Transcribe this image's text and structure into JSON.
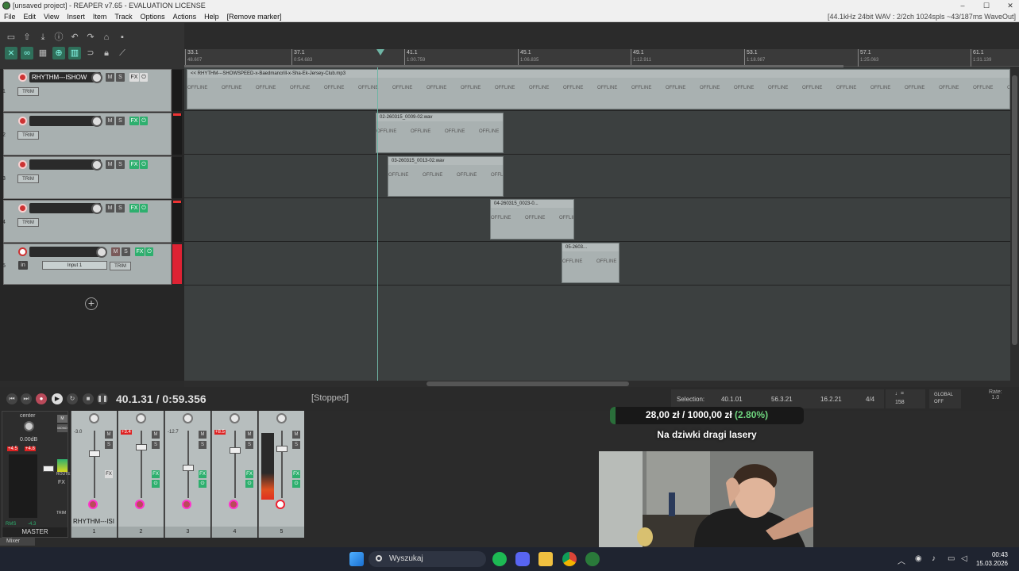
{
  "window": {
    "title": "[unsaved project] - REAPER v7.65 - EVALUATION LICENSE",
    "controls": [
      "–",
      "☐",
      "✕"
    ]
  },
  "menu": {
    "items": [
      "File",
      "Edit",
      "View",
      "Insert",
      "Item",
      "Track",
      "Options",
      "Actions",
      "Help",
      "[Remove marker]"
    ],
    "status": "[44.1kHz 24bit WAV : 2/2ch 1024spls ~43/187ms WaveOut]"
  },
  "ruler": {
    "marks": [
      {
        "bar": "33.1",
        "time": "48.607"
      },
      {
        "bar": "37.1",
        "time": "0:54.683"
      },
      {
        "bar": "41.1",
        "time": "1:00.759"
      },
      {
        "bar": "45.1",
        "time": "1:06.835"
      },
      {
        "bar": "49.1",
        "time": "1:12.911"
      },
      {
        "bar": "53.1",
        "time": "1:18.987"
      },
      {
        "bar": "57.1",
        "time": "1:25.063"
      },
      {
        "bar": "61.1",
        "time": "1:31.139"
      }
    ]
  },
  "tracks": [
    {
      "num": "1",
      "name": "RHYTHM---ISHOW",
      "fx": "FX",
      "trim": "TRIM"
    },
    {
      "num": "2",
      "name": "",
      "fx": "FX",
      "trim": "TRIM"
    },
    {
      "num": "3",
      "name": "",
      "fx": "FX",
      "trim": "TRIM"
    },
    {
      "num": "4",
      "name": "",
      "fx": "FX",
      "trim": "TRIM"
    },
    {
      "num": "5",
      "name": "",
      "fx": "FX",
      "trim": "TRIM",
      "input": "Input 1",
      "in": "in"
    }
  ],
  "track_buttons": {
    "mute": "M",
    "solo": "S"
  },
  "items": [
    {
      "label": "<< RHYTHM---SHOWSPEED-x-Baedmancrill-x-Sha-Ek-Jersey-Club.mp3",
      "offline": "OFFLINE"
    },
    {
      "label": "02-260315_0009-02.wav",
      "offline": "OFFLINE"
    },
    {
      "label": "03-260315_0013-02.wav",
      "offline": "OFFLINE"
    },
    {
      "label": "04-260315_0023-0...",
      "offline": "OFFLINE"
    },
    {
      "label": "05-2603...",
      "offline": "OFFLINE"
    }
  ],
  "transport": {
    "time": "40.1.31 / 0:59.356",
    "state": "[Stopped]",
    "selection_label": "Selection:",
    "selection_start": "40.1.01",
    "selection_end": "56.3.21",
    "selection_length": "16.2.21",
    "timesig": "4/4",
    "bpm": "158",
    "global": "GLOBAL",
    "global_state": "OFF",
    "rate_label": "Rate:",
    "rate_value": "1.0"
  },
  "mixer": {
    "master_label": "MASTER",
    "master_pan": "center",
    "master_db": "0.00dB",
    "master_peak_l": "+4.5",
    "master_peak_r": "+4.8",
    "master_rms": "RMS",
    "master_rms_val": "-4.3",
    "master_buttons": [
      "MONO",
      "ROUTE",
      "FX",
      "TRIM"
    ],
    "strips": [
      {
        "num": "1",
        "name": "RHYTHM---ISI",
        "db": "-3.0",
        "peak": false
      },
      {
        "num": "2",
        "name": "",
        "db": "+3.4",
        "peak": true
      },
      {
        "num": "3",
        "name": "",
        "db": "-12.7",
        "peak": false
      },
      {
        "num": "4",
        "name": "",
        "db": "+8.5",
        "peak": true
      },
      {
        "num": "5",
        "name": "",
        "db": "",
        "peak": false
      }
    ],
    "tab": "Mixer"
  },
  "overlay": {
    "donation_amount": "28,00 zł",
    "donation_separator": "/",
    "donation_goal": "1000,00 zł",
    "donation_pct": "(2.80%)",
    "donation_progress": 0.028,
    "donation_title": "Na dziwki dragi lasery"
  },
  "taskbar": {
    "search_placeholder": "Wyszukaj",
    "time": "00:43",
    "date": "15.03.2026"
  },
  "colors": {
    "accent": "#6fb5a5",
    "fx_on": "#2eaf6e",
    "record": "#b94a5a",
    "peak": "#d22222"
  }
}
